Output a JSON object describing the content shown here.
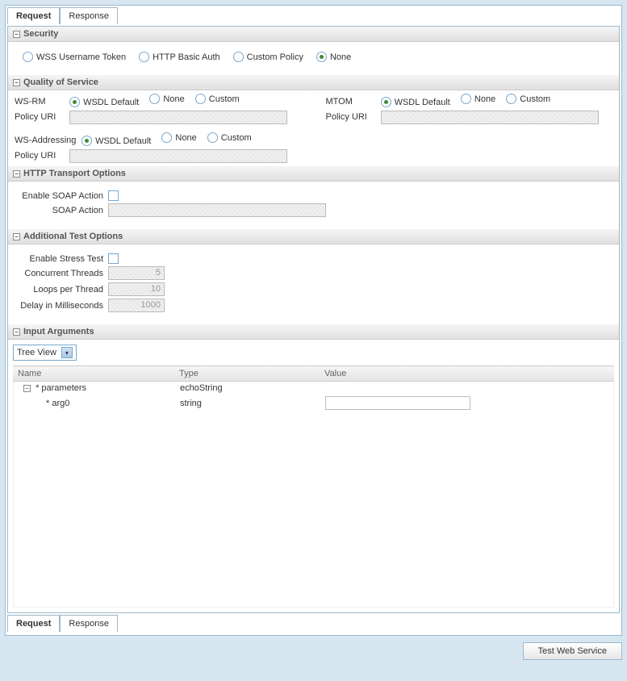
{
  "tabs": {
    "request": "Request",
    "response": "Response"
  },
  "sections": {
    "security": {
      "title": "Security",
      "options": {
        "wss": "WSS Username Token",
        "basic": "HTTP Basic Auth",
        "custom": "Custom Policy",
        "none": "None"
      }
    },
    "qos": {
      "title": "Quality of Service",
      "wsrm": "WS-RM",
      "wsaddr": "WS-Addressing",
      "mtom": "MTOM",
      "options": {
        "wsdl_default": "WSDL Default",
        "none": "None",
        "custom": "Custom"
      },
      "policy_uri": "Policy URI"
    },
    "http": {
      "title": "HTTP Transport Options",
      "enable_soap_action": "Enable SOAP Action",
      "soap_action": "SOAP Action"
    },
    "additional": {
      "title": "Additional Test Options",
      "enable_stress": "Enable Stress Test",
      "concurrent": "Concurrent Threads",
      "concurrent_val": "5",
      "loops": "Loops per Thread",
      "loops_val": "10",
      "delay": "Delay in Milliseconds",
      "delay_val": "1000"
    },
    "input": {
      "title": "Input Arguments",
      "view": "Tree View",
      "cols": {
        "name": "Name",
        "type": "Type",
        "value": "Value"
      },
      "rows": [
        {
          "name": "* parameters",
          "type": "echoString",
          "level": 0,
          "expandable": true
        },
        {
          "name": "* arg0",
          "type": "string",
          "level": 1,
          "expandable": false,
          "has_value_input": true
        }
      ]
    }
  },
  "footer_button": "Test Web Service"
}
